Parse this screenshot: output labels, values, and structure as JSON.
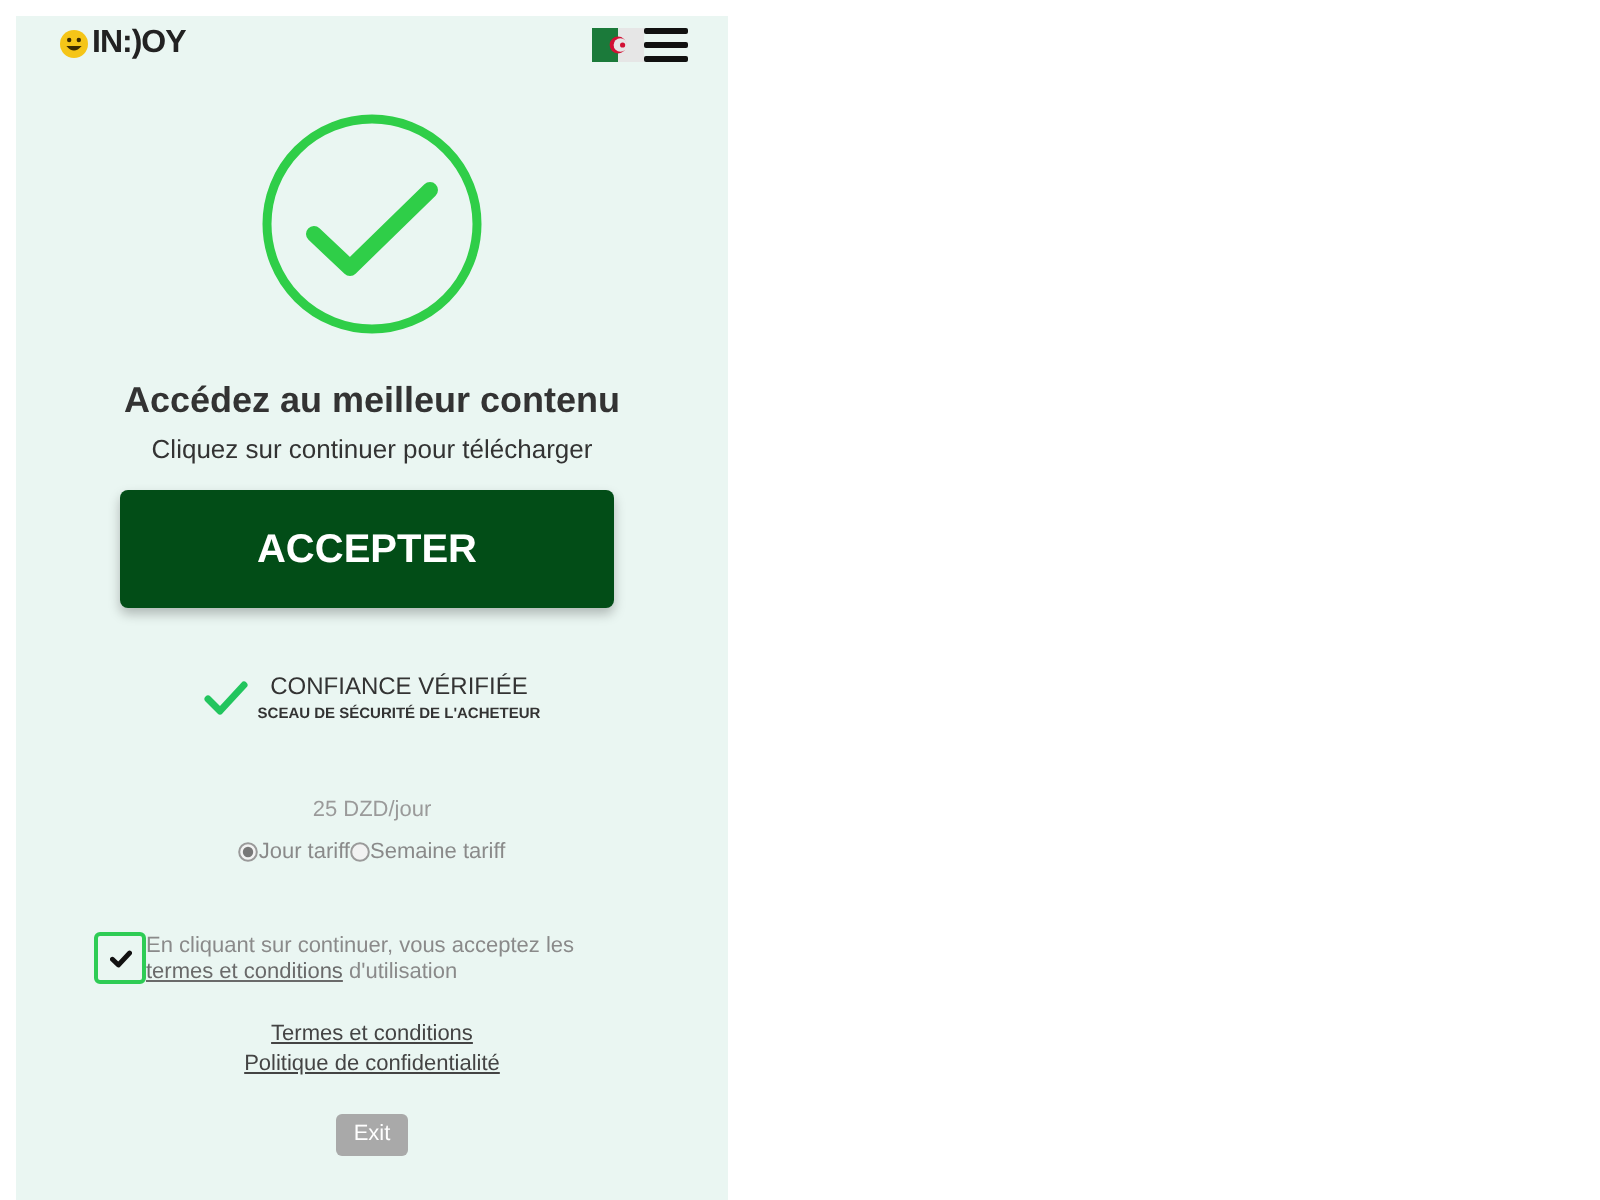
{
  "header": {
    "logo_text": "IN:)OY"
  },
  "hero": {
    "heading": "Accédez au meilleur contenu",
    "subheading": "Cliquez sur continuer pour télécharger"
  },
  "accept_button": {
    "label": "ACCEPTER"
  },
  "trust": {
    "title": "CONFIANCE VÉRIFIÉE",
    "subtitle": "SCEAU DE SÉCURITÉ DE L'ACHETEUR"
  },
  "price": "25 DZD/jour",
  "plans": [
    {
      "label": "Jour tariff",
      "selected": true
    },
    {
      "label": "Semaine tariff",
      "selected": false
    }
  ],
  "consent": {
    "checked": true,
    "text_before": "En cliquant sur continuer, vous acceptez les",
    "link": "termes et conditions",
    "text_after": "d'utilisation"
  },
  "footer_links": [
    "Termes et conditions",
    "Politique de confidentialité"
  ],
  "exit_button": {
    "label": "Exit"
  }
}
